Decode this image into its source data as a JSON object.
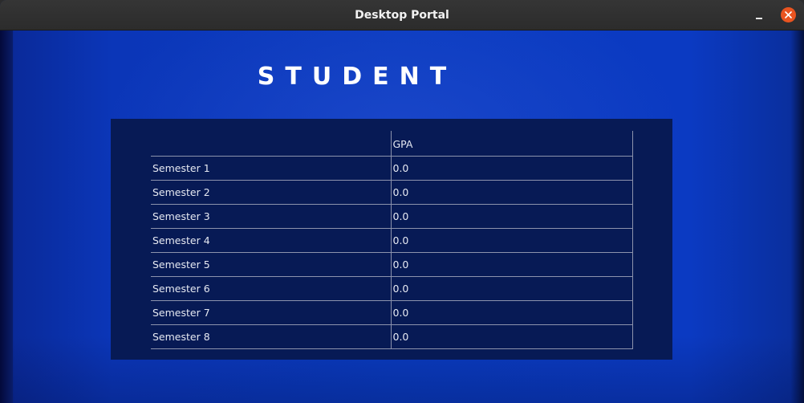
{
  "window": {
    "title": "Desktop Portal"
  },
  "heading": "STUDENT",
  "table": {
    "columns": [
      "",
      "GPA"
    ],
    "rows": [
      {
        "label": "Semester 1",
        "gpa": "0.0"
      },
      {
        "label": "Semester 2",
        "gpa": "0.0"
      },
      {
        "label": "Semester 3",
        "gpa": "0.0"
      },
      {
        "label": "Semester 4",
        "gpa": "0.0"
      },
      {
        "label": "Semester 5",
        "gpa": "0.0"
      },
      {
        "label": "Semester 6",
        "gpa": "0.0"
      },
      {
        "label": "Semester 7",
        "gpa": "0.0"
      },
      {
        "label": "Semester 8",
        "gpa": "0.0"
      }
    ]
  },
  "colors": {
    "background": "#0b36b8",
    "panel": "#071a55",
    "close_button": "#e95420",
    "text": "#ffffff"
  },
  "icons": {
    "minimize": "minimize-icon",
    "close": "close-icon"
  }
}
